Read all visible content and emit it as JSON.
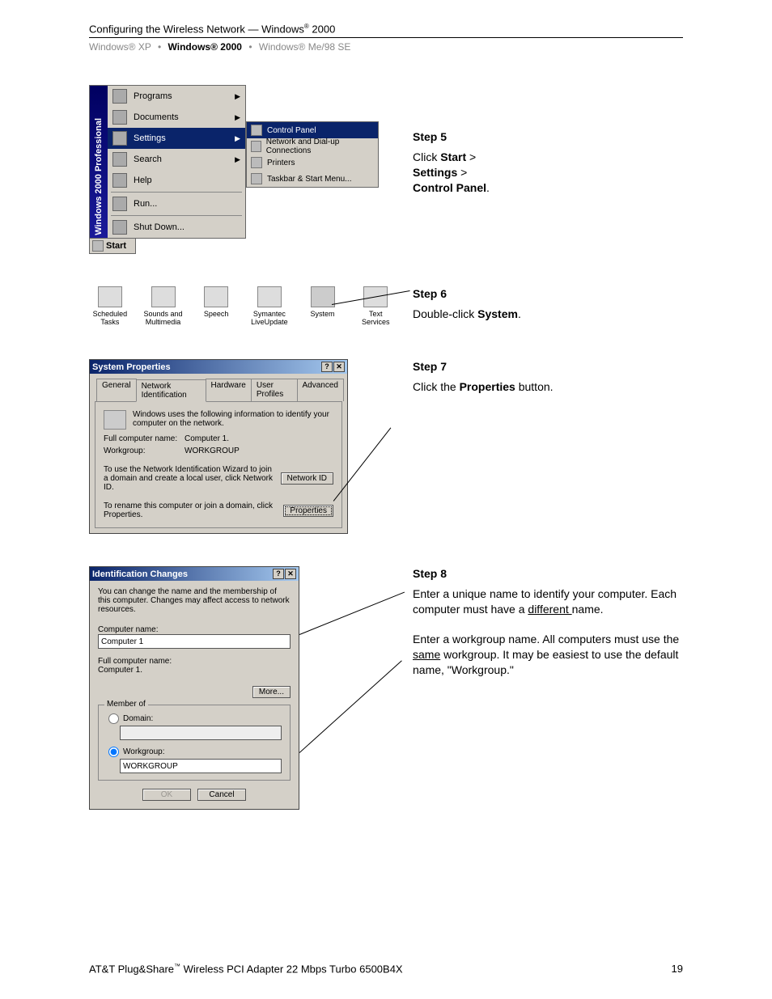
{
  "header": {
    "title_prefix": "Configuring the Wireless Network — Windows",
    "title_suffix": " 2000",
    "subnav": {
      "xp": "Windows® XP",
      "w2k": "Windows® 2000",
      "me98": "Windows® Me/98 SE"
    }
  },
  "step5": {
    "label": "Step 5",
    "line1a": "Click ",
    "line1b": "Start",
    "line1c": " > ",
    "line2a": "Settings",
    "line2b": " > ",
    "line3a": "Control Panel",
    "line3b": ".",
    "menu": {
      "sidebar": "Windows 2000 Professional",
      "items": [
        "Programs",
        "Documents",
        "Settings",
        "Search",
        "Help",
        "Run...",
        "Shut Down..."
      ],
      "start": "Start",
      "sub": [
        "Control Panel",
        "Network and Dial-up Connections",
        "Printers",
        "Taskbar & Start Menu..."
      ]
    }
  },
  "step6": {
    "label": "Step 6",
    "text_a": "Double-click ",
    "text_b": "System",
    "text_c": ".",
    "icons": [
      "Scheduled Tasks",
      "Sounds and Multimedia",
      "Speech",
      "Symantec LiveUpdate",
      "System",
      "Text Services"
    ]
  },
  "step7": {
    "label": "Step 7",
    "text_a": "Click the ",
    "text_b": "Properties",
    "text_c": " button.",
    "win": {
      "title": "System Properties",
      "tabs": [
        "General",
        "Network Identification",
        "Hardware",
        "User Profiles",
        "Advanced"
      ],
      "info": "Windows uses the following information to identify your computer on the network.",
      "name_k": "Full computer name:",
      "name_v": "Computer 1.",
      "wg_k": "Workgroup:",
      "wg_v": "WORKGROUP",
      "row1": "To use the Network Identification Wizard to join a domain and create a local user, click Network ID.",
      "btn1": "Network ID",
      "row2": "To rename this computer or join a domain, click Properties.",
      "btn2": "Properties"
    }
  },
  "step8": {
    "label": "Step 8",
    "p1a": "Enter a unique name to identify your computer. Each computer must have a ",
    "p1b": "different ",
    "p1c": "name.",
    "p2a": "Enter a workgroup name. All computers must use the ",
    "p2b": "same",
    "p2c": " workgroup. It may be easiest to use the default name, \"Workgroup.\"",
    "win": {
      "title": "Identification Changes",
      "desc": "You can change the name and the membership of this computer. Changes may affect access to network resources.",
      "cname_lbl": "Computer name:",
      "cname_val": "Computer 1",
      "full_lbl": "Full computer name:",
      "full_val": "Computer 1.",
      "more": "More...",
      "group": "Member of",
      "domain": "Domain:",
      "workgroup": "Workgroup:",
      "wg_val": "WORKGROUP",
      "ok": "OK",
      "cancel": "Cancel"
    }
  },
  "footer": {
    "left_a": "AT&T Plug&Share",
    "left_b": " Wireless PCI Adapter 22 Mbps Turbo 6500B4X",
    "page": "19"
  }
}
